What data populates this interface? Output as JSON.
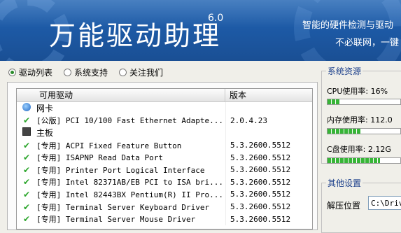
{
  "header": {
    "title": "万能驱动助理",
    "version": "6.0",
    "slogan_line1": "智能的硬件检测与驱动",
    "slogan_line2": "不必联网，一键"
  },
  "tabs": [
    {
      "label": "驱动列表",
      "selected": true
    },
    {
      "label": "系统支持",
      "selected": false
    },
    {
      "label": "关注我们",
      "selected": false
    }
  ],
  "driver_table": {
    "columns": [
      "可用驱动",
      "版本"
    ],
    "rows": [
      {
        "type": "category",
        "icon": "network-card-icon",
        "name": "网卡",
        "version": ""
      },
      {
        "type": "driver",
        "icon": "check-icon",
        "name": "[公版] PCI 10/100 Fast Ethernet Adapte...",
        "version": "2.0.4.23"
      },
      {
        "type": "category",
        "icon": "motherboard-icon",
        "name": "主板",
        "version": ""
      },
      {
        "type": "driver",
        "icon": "check-icon",
        "name": "[专用] ACPI Fixed Feature Button",
        "version": "5.3.2600.5512"
      },
      {
        "type": "driver",
        "icon": "check-icon",
        "name": "[专用] ISAPNP Read Data Port",
        "version": "5.3.2600.5512"
      },
      {
        "type": "driver",
        "icon": "check-icon",
        "name": "[专用] Printer Port Logical Interface",
        "version": "5.3.2600.5512"
      },
      {
        "type": "driver",
        "icon": "check-icon",
        "name": "[专用] Intel 82371AB/EB PCI to ISA bri...",
        "version": "5.3.2600.5512"
      },
      {
        "type": "driver",
        "icon": "check-icon",
        "name": "[专用] Intel 82443BX Pentium(R) II Pro...",
        "version": "5.3.2600.5512"
      },
      {
        "type": "driver",
        "icon": "check-icon",
        "name": "[专用] Terminal Server Keyboard Driver",
        "version": "5.3.2600.5512"
      },
      {
        "type": "driver",
        "icon": "check-icon",
        "name": "[专用] Terminal Server Mouse Driver",
        "version": "5.3.2600.5512"
      }
    ]
  },
  "system_resources": {
    "title": "系统资源",
    "cpu": {
      "label": "CPU使用率: ",
      "value": "16%",
      "fill": 0.16
    },
    "memory": {
      "label": "内存使用率: ",
      "value": "112.0",
      "fill": 0.45
    },
    "disk": {
      "label": "C盘使用率: ",
      "value": "2.12G",
      "fill": 0.72
    }
  },
  "other_settings": {
    "title": "其他设置",
    "extract_label": "解压位置",
    "extract_value": "C:\\Driv"
  },
  "colors": {
    "banner": "#1d5aa6",
    "check": "#2aa52a",
    "bar_fill": "#37b537"
  }
}
